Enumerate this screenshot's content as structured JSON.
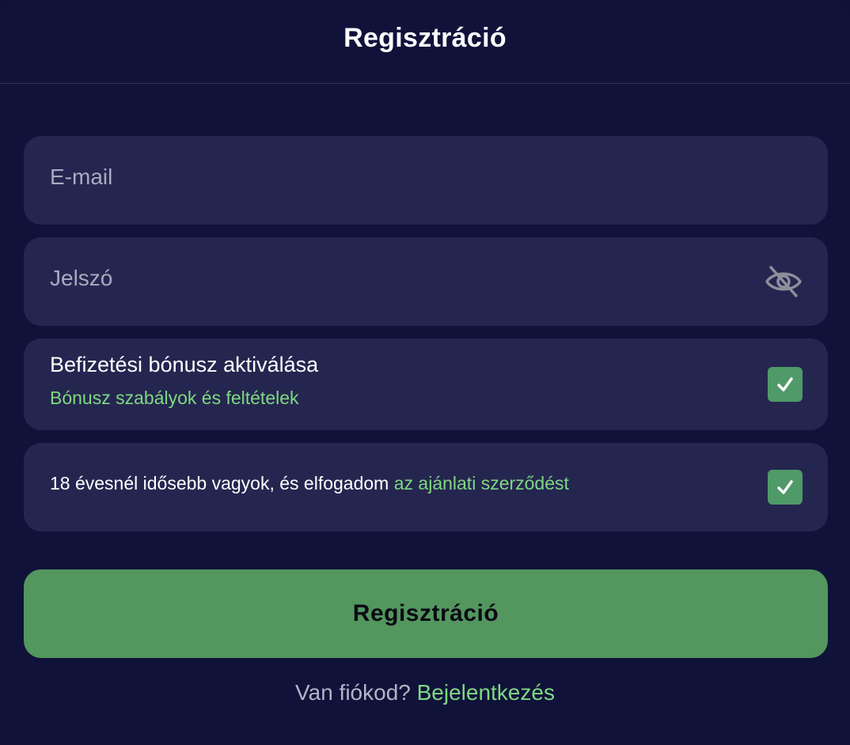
{
  "header": {
    "title": "Regisztráció"
  },
  "form": {
    "email": {
      "placeholder": "E-mail",
      "value": ""
    },
    "password": {
      "placeholder": "Jelszó",
      "value": "",
      "toggle_icon": "eye-off-icon"
    },
    "bonus": {
      "label": "Befizetési bónusz aktiválása",
      "link": "Bónusz szabályok és feltételek",
      "checked": true
    },
    "terms": {
      "text": "18 évesnél idősebb vagyok, és elfogadom ",
      "link": "az ajánlati szerződést",
      "checked": true
    },
    "submit_label": "Regisztráció"
  },
  "footer": {
    "question": "Van fiókod?",
    "login_link": "Bejelentkezés"
  },
  "colors": {
    "background": "#10123a",
    "field": "#252650",
    "accent": "#53965e",
    "link": "#7fd882"
  }
}
